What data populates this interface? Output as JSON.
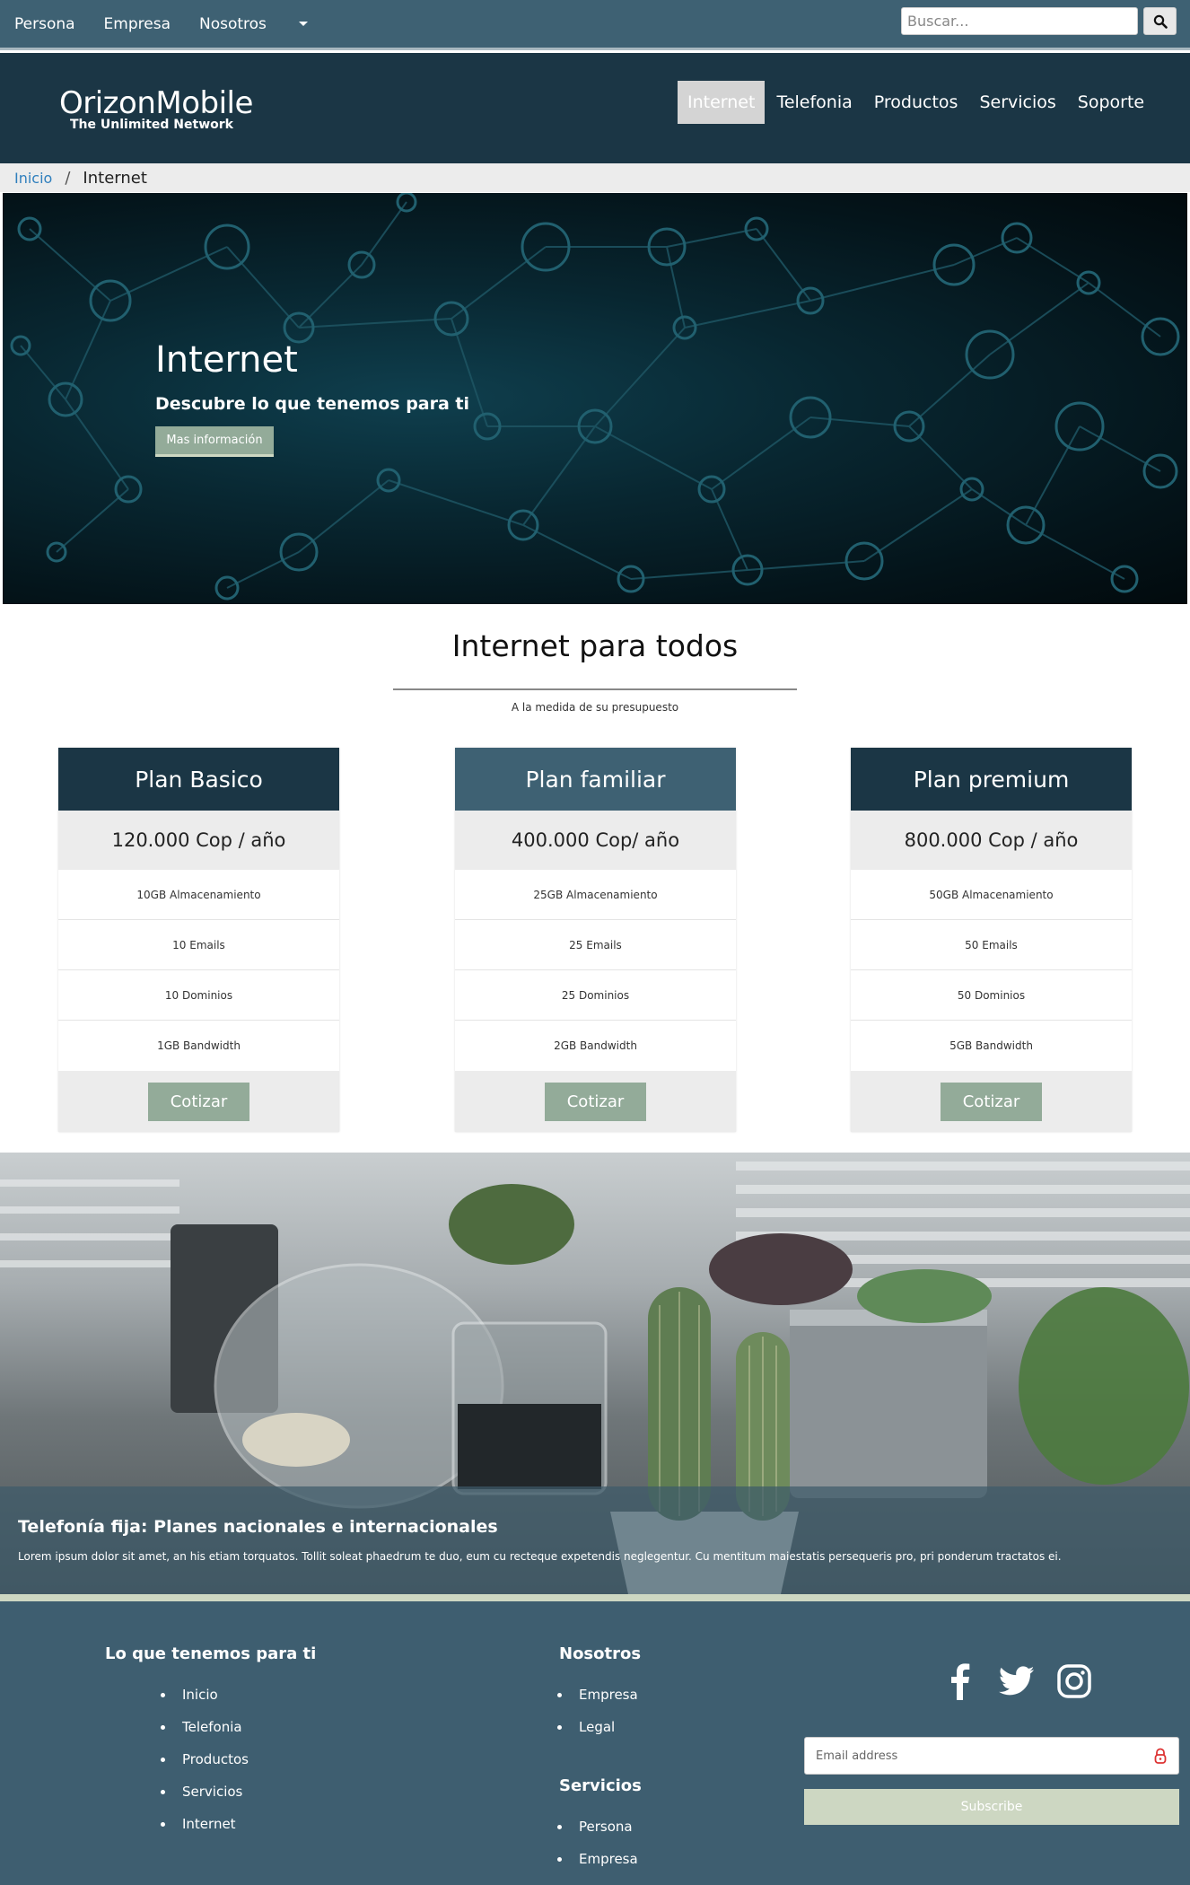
{
  "topbar": {
    "links": [
      "Persona",
      "Empresa",
      "Nosotros"
    ],
    "search": {
      "placeholder": "Buscar..."
    }
  },
  "header": {
    "brand": "OrizonMobile",
    "tagline": "The Unlimited Network",
    "nav": [
      {
        "label": "Internet",
        "active": true
      },
      {
        "label": "Telefonia",
        "active": false
      },
      {
        "label": "Productos",
        "active": false
      },
      {
        "label": "Servicios",
        "active": false
      },
      {
        "label": "Soporte",
        "active": false
      }
    ]
  },
  "breadcrumb": {
    "home": "Inicio",
    "separator": "/",
    "current": "Internet"
  },
  "hero": {
    "title": "Internet",
    "subtitle": "Descubre lo que tenemos para ti",
    "button": "Mas información"
  },
  "pricing": {
    "title": "Internet para todos",
    "subtitle": "A la medida de su presupuesto",
    "plans": [
      {
        "name": "Plan Basico",
        "header_color": "#1b3645",
        "price": "120.000 Cop / año",
        "features": [
          "10GB Almacenamiento",
          "10 Emails",
          "10 Dominios",
          "1GB Bandwidth"
        ],
        "button": "Cotizar"
      },
      {
        "name": "Plan familiar",
        "header_color": "#3e6173",
        "price": "400.000 Cop/ año",
        "features": [
          "25GB Almacenamiento",
          "25 Emails",
          "25 Dominios",
          "2GB Bandwidth"
        ],
        "button": "Cotizar"
      },
      {
        "name": "Plan premium",
        "header_color": "#1b3645",
        "price": "800.000 Cop / año",
        "features": [
          "50GB Almacenamiento",
          "50 Emails",
          "50 Dominios",
          "5GB Bandwidth"
        ],
        "button": "Cotizar"
      }
    ]
  },
  "banner": {
    "title": "Telefonía fija: Planes nacionales e internacionales",
    "text": "Lorem ipsum dolor sit amet, an his etiam torquatos. Tollit soleat phaedrum te duo, eum cu recteque expetendis neglegentur. Cu mentitum maiestatis persequeris pro, pri ponderum tractatos ei."
  },
  "footer": {
    "col1": {
      "title": "Lo que tenemos para ti",
      "items": [
        "Inicio",
        "Telefonia",
        "Productos",
        "Servicios",
        "Internet"
      ]
    },
    "col2": {
      "title": "Nosotros",
      "items": [
        "Empresa",
        "Legal"
      ]
    },
    "col3": {
      "title": "Servicios",
      "items": [
        "Persona",
        "Empresa"
      ]
    },
    "social": [
      "facebook-icon",
      "twitter-icon",
      "instagram-icon"
    ],
    "newsletter": {
      "placeholder": "Email address",
      "button": "Subscribe"
    }
  },
  "colors": {
    "dark_navy": "#1b3645",
    "slate_blue": "#3e6173",
    "sage_button": "#93ab99",
    "light_sage": "#cdd7c2",
    "link_blue": "#2f7fbd"
  }
}
